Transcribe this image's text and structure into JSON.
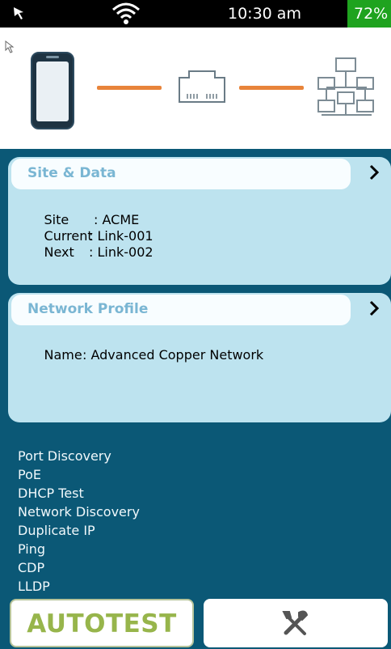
{
  "status_bar": {
    "time": "10:30 am",
    "battery": "72%"
  },
  "site_card": {
    "title": "Site & Data",
    "fields": [
      {
        "label": "Site",
        "value": ": ACME"
      },
      {
        "label": "Current",
        "value": ": Link-001"
      },
      {
        "label": "Next",
        "value": ": Link-002"
      }
    ]
  },
  "profile_card": {
    "title": "Network Profile",
    "fields": [
      {
        "label": "Name",
        "value": ": Advanced Copper Network"
      }
    ]
  },
  "tests": [
    "Port Discovery",
    "PoE",
    "DHCP Test",
    "Network Discovery",
    "Duplicate IP",
    "Ping",
    "CDP",
    "LLDP"
  ],
  "buttons": {
    "autotest": "AUTOTEST"
  },
  "icons": {
    "cursor": "cursor-arrow-icon",
    "wifi": "wifi-icon",
    "tester": "handheld-tester-icon",
    "port": "ethernet-port-icon",
    "network": "network-topology-icon",
    "chevron": "chevron-right-icon",
    "tools": "tools-icon"
  },
  "colors": {
    "main_background": "#0b5876",
    "card_background": "#bde3ef",
    "card_title": "#7ab6d3",
    "link_line": "#e8843a",
    "battery": "#1fa31f",
    "autotest_text": "#97b54b"
  }
}
